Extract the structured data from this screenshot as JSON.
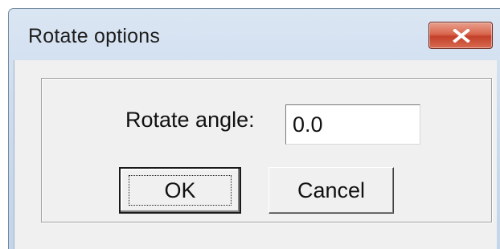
{
  "window": {
    "title": "Rotate options",
    "close_icon": "close-x-icon"
  },
  "form": {
    "angle_label": "Rotate angle:",
    "angle_value": "0.0"
  },
  "buttons": {
    "ok_label": "OK",
    "cancel_label": "Cancel"
  },
  "colors": {
    "title_bar": "#c3d5ea",
    "close_button": "#c4402a",
    "client_background": "#f0f0f0"
  }
}
